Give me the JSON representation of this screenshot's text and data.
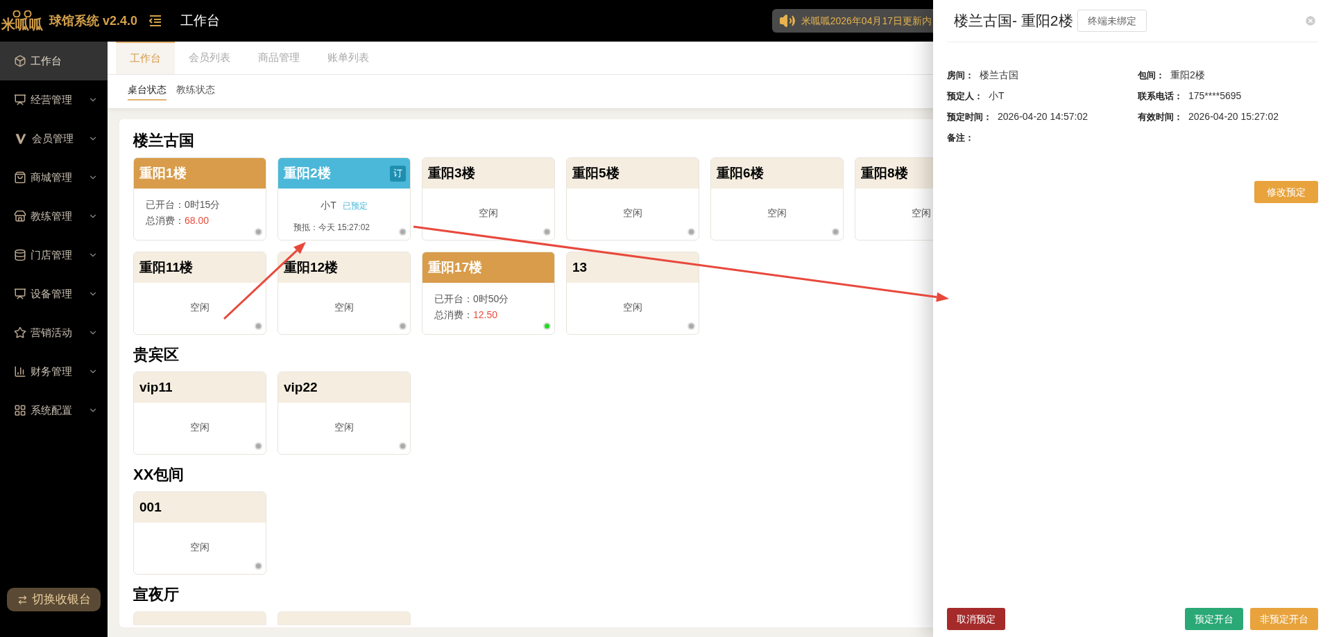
{
  "header": {
    "logo_text": "米呱呱",
    "app_name": "球馆系统 v2.4.0",
    "page_title": "工作台",
    "notice": "米呱呱2026年04月17日更新内"
  },
  "sidebar": {
    "items": [
      {
        "label": "工作台",
        "selected": true,
        "has_children": false
      },
      {
        "label": "经营管理",
        "selected": false,
        "has_children": true
      },
      {
        "label": "会员管理",
        "selected": false,
        "has_children": true
      },
      {
        "label": "商城管理",
        "selected": false,
        "has_children": true
      },
      {
        "label": "教练管理",
        "selected": false,
        "has_children": true
      },
      {
        "label": "门店管理",
        "selected": false,
        "has_children": true
      },
      {
        "label": "设备管理",
        "selected": false,
        "has_children": true
      },
      {
        "label": "营销活动",
        "selected": false,
        "has_children": true
      },
      {
        "label": "财务管理",
        "selected": false,
        "has_children": true
      },
      {
        "label": "系统配置",
        "selected": false,
        "has_children": true
      }
    ],
    "switch_button": "切换收银台"
  },
  "tabs": [
    {
      "label": "工作台",
      "selected": true
    },
    {
      "label": "会员列表",
      "selected": false
    },
    {
      "label": "商品管理",
      "selected": false
    },
    {
      "label": "账单列表",
      "selected": false
    }
  ],
  "sub_tabs": [
    {
      "label": "桌台状态",
      "selected": true
    },
    {
      "label": "教练状态",
      "selected": false
    }
  ],
  "sections": [
    {
      "title": "楼兰古国",
      "cards": [
        {
          "kind": "in_use",
          "name": "重阳1楼",
          "open_label": "已开台：",
          "open_time": "0时15分",
          "spend_label": "总消费：",
          "spend": "68.00",
          "color": "#aaaaaa"
        },
        {
          "kind": "reserved",
          "name": "重阳2楼",
          "badge": "订",
          "guest": "小T",
          "status": "已预定",
          "arrival": "预抵：今天 15:27:02",
          "color": "#aaaaaa"
        },
        {
          "kind": "idle",
          "name": "重阳3楼",
          "status": "空闲",
          "color": "#aaaaaa"
        },
        {
          "kind": "idle",
          "name": "重阳5楼",
          "status": "空闲",
          "color": "#aaaaaa"
        },
        {
          "kind": "idle",
          "name": "重阳6楼",
          "status": "空闲",
          "color": "#aaaaaa"
        },
        {
          "kind": "idle",
          "name": "重阳8楼",
          "status": "空闲"
        },
        {
          "kind": "idle",
          "name": "重阳11楼",
          "status": "空闲",
          "color": "#aaaaaa"
        },
        {
          "kind": "idle",
          "name": "重阳12楼",
          "status": "空闲",
          "color": "#aaaaaa"
        },
        {
          "kind": "in_use",
          "name": "重阳17楼",
          "open_label": "已开台：",
          "open_time": "0时50分",
          "spend_label": "总消费：",
          "spend": "12.50",
          "color": "#22dd22"
        },
        {
          "kind": "idle",
          "name": "13",
          "status": "空闲",
          "color": "#aaaaaa"
        }
      ]
    },
    {
      "title": "贵宾区",
      "cards": [
        {
          "kind": "idle",
          "name": "vip11",
          "status": "空闲",
          "color": "#aaaaaa"
        },
        {
          "kind": "idle",
          "name": "vip22",
          "status": "空闲",
          "color": "#aaaaaa"
        }
      ]
    },
    {
      "title": "XX包间",
      "cards": [
        {
          "kind": "idle",
          "name": "001",
          "status": "空闲",
          "color": "#aaaaaa"
        }
      ]
    },
    {
      "title": "宣夜厅",
      "cards": [
        {
          "kind": "cut"
        },
        {
          "kind": "cut"
        }
      ]
    }
  ],
  "drawer": {
    "title": "楼兰古国- 重阳2楼",
    "terminal": "终端未绑定",
    "fields": [
      {
        "label": "房间：",
        "value": "楼兰古国"
      },
      {
        "label": "包间：",
        "value": "重阳2楼"
      },
      {
        "label": "预定人：",
        "value": "小T"
      },
      {
        "label": "联系电话：",
        "value": "175****5695"
      },
      {
        "label": "预定时间：",
        "value": "2026-04-20 14:57:02"
      },
      {
        "label": "有效时间：",
        "value": "2026-04-20 15:27:02"
      },
      {
        "label": "备注："
      }
    ],
    "edit_button": "修改预定",
    "buttons": [
      {
        "kind": "danger",
        "label": "取消预定"
      },
      {
        "kind": "success",
        "label": "预定开台"
      },
      {
        "kind": "warning",
        "label": "非预定开台"
      }
    ]
  }
}
